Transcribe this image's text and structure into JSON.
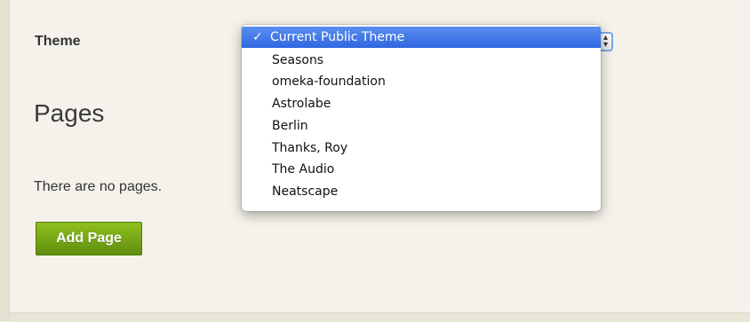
{
  "form": {
    "theme_label": "Theme"
  },
  "theme_select": {
    "selected": "Current Public Theme",
    "check_mark": "✓",
    "options": [
      "Current Public Theme",
      "Seasons",
      "omeka-foundation",
      "Astrolabe",
      "Berlin",
      "Thanks, Roy",
      "The Audio",
      "Neatscape"
    ]
  },
  "pages_section": {
    "heading": "Pages",
    "empty_message": "There are no pages.",
    "add_button_label": "Add Page"
  },
  "colors": {
    "button_green": "#7aaa18",
    "selection_blue": "#3b73e6",
    "background": "#efece0"
  }
}
